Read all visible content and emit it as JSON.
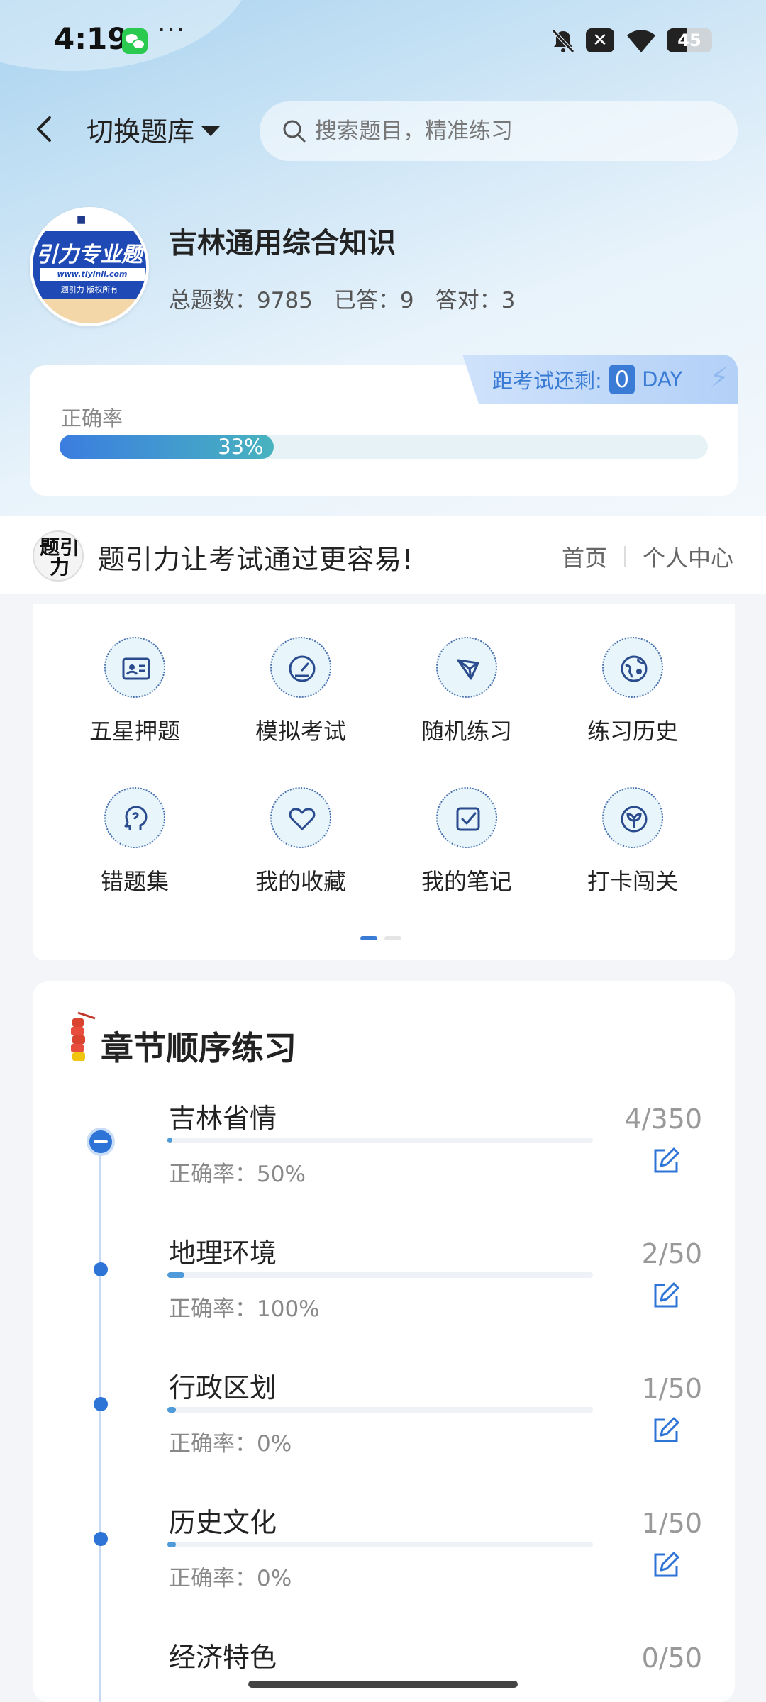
{
  "status_bar": {
    "time": "4:19",
    "more": "···",
    "battery": "45",
    "icons": [
      "wechat-icon",
      "bell-off-icon",
      "close-box-icon",
      "wifi-icon",
      "battery-icon"
    ]
  },
  "header": {
    "switch_bank": "切换题库",
    "search_placeholder": "搜索题目，精准练习"
  },
  "bank": {
    "logo_title": "引力专业题",
    "logo_url": "www.tiyinli.com",
    "logo_copy": "题引力 版权所有",
    "title": "吉林通用综合知识",
    "stats": {
      "total": "总题数：9785",
      "answered": "已答：9",
      "correct": "答对：3"
    }
  },
  "accuracy": {
    "label": "正确率",
    "value_text": "33%",
    "value": 0.33,
    "countdown_label": "距考试还剩:",
    "countdown_value": "0",
    "countdown_unit": "DAY"
  },
  "promo": {
    "logo_text": "题引力",
    "text": "题引力让考试通过更容易!",
    "links": [
      "首页",
      "个人中心"
    ]
  },
  "grid": {
    "items": [
      {
        "label": "五星押题",
        "icon": "id-card-icon"
      },
      {
        "label": "模拟考试",
        "icon": "gauge-icon"
      },
      {
        "label": "随机练习",
        "icon": "random-icon"
      },
      {
        "label": "练习历史",
        "icon": "globe-icon"
      },
      {
        "label": "错题集",
        "icon": "head-icon"
      },
      {
        "label": "我的收藏",
        "icon": "heart-icon"
      },
      {
        "label": "我的笔记",
        "icon": "note-check-icon"
      },
      {
        "label": "打卡闯关",
        "icon": "sprout-icon"
      }
    ],
    "page": 1,
    "pages": 2
  },
  "chapters": {
    "title": "章节顺序练习",
    "items": [
      {
        "name": "吉林省情",
        "accuracy": "正确率：50%",
        "count": "4/350",
        "progress": 0.0114
      },
      {
        "name": "地理环境",
        "accuracy": "正确率：100%",
        "count": "2/50",
        "progress": 0.04
      },
      {
        "name": "行政区划",
        "accuracy": "正确率：0%",
        "count": "1/50",
        "progress": 0.02
      },
      {
        "name": "历史文化",
        "accuracy": "正确率：0%",
        "count": "1/50",
        "progress": 0.02
      },
      {
        "name": "经济特色",
        "accuracy": "",
        "count": "0/50",
        "progress": 0
      }
    ]
  },
  "colors": {
    "accent": "#3a7bd5",
    "progress_start": "#3b7de0",
    "progress_end": "#48b3bf"
  }
}
